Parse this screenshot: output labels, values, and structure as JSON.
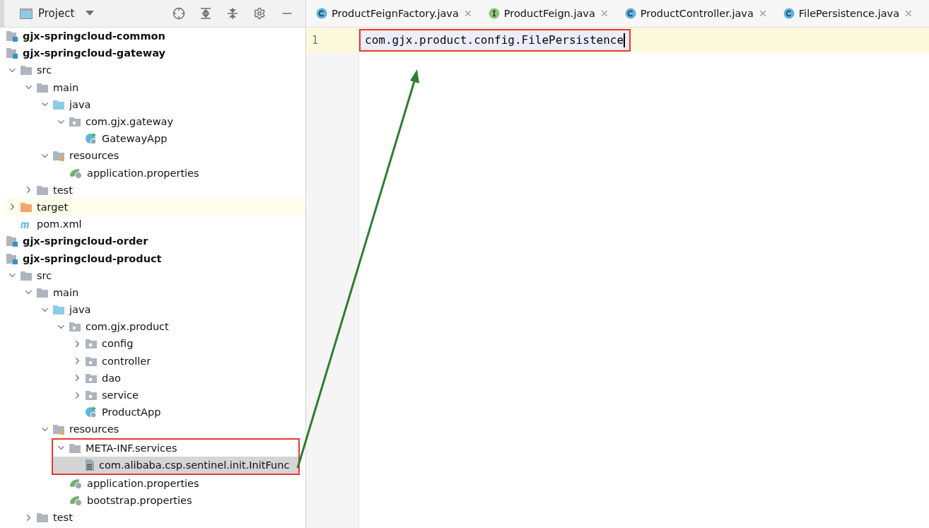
{
  "project_panel": {
    "title": "Project",
    "tree": [
      {
        "name": "gjx-springcloud-common",
        "kind": "module"
      },
      {
        "name": "gjx-springcloud-gateway",
        "kind": "module",
        "children": [
          {
            "name": "src",
            "kind": "folder",
            "expanded": true,
            "children": [
              {
                "name": "main",
                "kind": "folder",
                "expanded": true,
                "children": [
                  {
                    "name": "java",
                    "kind": "source",
                    "expanded": true,
                    "children": [
                      {
                        "name": "com.gjx.gateway",
                        "kind": "package",
                        "expanded": true,
                        "children": [
                          {
                            "name": "GatewayApp",
                            "kind": "app"
                          }
                        ]
                      }
                    ]
                  },
                  {
                    "name": "resources",
                    "kind": "resources",
                    "expanded": true,
                    "children": [
                      {
                        "name": "application.properties",
                        "kind": "properties"
                      }
                    ]
                  }
                ]
              },
              {
                "name": "test",
                "kind": "folder",
                "expanded": false
              }
            ]
          },
          {
            "name": "target",
            "kind": "excluded",
            "expanded": false
          },
          {
            "name": "pom.xml",
            "kind": "maven"
          }
        ]
      },
      {
        "name": "gjx-springcloud-order",
        "kind": "module"
      },
      {
        "name": "gjx-springcloud-product",
        "kind": "module",
        "children": [
          {
            "name": "src",
            "kind": "folder",
            "expanded": true,
            "children": [
              {
                "name": "main",
                "kind": "folder",
                "expanded": true,
                "children": [
                  {
                    "name": "java",
                    "kind": "source",
                    "expanded": true,
                    "children": [
                      {
                        "name": "com.gjx.product",
                        "kind": "package",
                        "expanded": true,
                        "children": [
                          {
                            "name": "config",
                            "kind": "package",
                            "expanded": false
                          },
                          {
                            "name": "controller",
                            "kind": "package",
                            "expanded": false
                          },
                          {
                            "name": "dao",
                            "kind": "package",
                            "expanded": false
                          },
                          {
                            "name": "service",
                            "kind": "package",
                            "expanded": false
                          },
                          {
                            "name": "ProductApp",
                            "kind": "app"
                          }
                        ]
                      }
                    ]
                  },
                  {
                    "name": "resources",
                    "kind": "resources",
                    "expanded": true,
                    "children": [
                      {
                        "name": "META-INF.services",
                        "kind": "folder",
                        "expanded": true,
                        "boxed": true,
                        "children": [
                          {
                            "name": "com.alibaba.csp.sentinel.init.InitFunc",
                            "kind": "text",
                            "selected": true
                          }
                        ]
                      },
                      {
                        "name": "application.properties",
                        "kind": "properties"
                      },
                      {
                        "name": "bootstrap.properties",
                        "kind": "cloud-properties"
                      }
                    ]
                  }
                ]
              },
              {
                "name": "test",
                "kind": "folder",
                "expanded": false
              }
            ]
          }
        ]
      }
    ]
  },
  "editor": {
    "tabs": [
      {
        "label": "ProductFeignFactory.java",
        "kind": "class"
      },
      {
        "label": "ProductFeign.java",
        "kind": "interface"
      },
      {
        "label": "ProductController.java",
        "kind": "class"
      },
      {
        "label": "FilePersistence.java",
        "kind": "class"
      }
    ],
    "lines": [
      {
        "number": "1",
        "text": "com.gjx.product.config.FilePersistence",
        "current": true,
        "boxed": true
      }
    ]
  }
}
